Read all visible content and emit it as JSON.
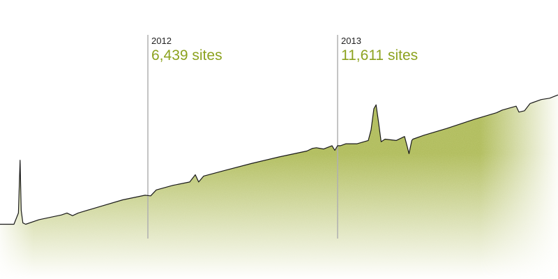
{
  "colors": {
    "accent": "#8ca21f",
    "fill": "#b9c56a",
    "line": "#1a1a1a",
    "marker_line": "#b0b0b0"
  },
  "annotations": [
    {
      "year": "2012",
      "value": "6,439 sites"
    },
    {
      "year": "2013",
      "value": "11,611 sites"
    }
  ],
  "chart_data": {
    "type": "area",
    "title": "",
    "xlabel": "",
    "ylabel": "",
    "grid": false,
    "legend": "none",
    "markers": [
      {
        "x": 26.5,
        "label": "2012",
        "value_label": "6,439 sites",
        "value": 6439
      },
      {
        "x": 60.5,
        "label": "2013",
        "value_label": "11,611 sites",
        "value": 11611
      }
    ],
    "series": [
      {
        "x": [
          0,
          2.5,
          3.3,
          3.6,
          3.8,
          4.1,
          4.6,
          7,
          11,
          12,
          13,
          14,
          18,
          22,
          26,
          27,
          28,
          31,
          34,
          35,
          35.6,
          36.5,
          40,
          45,
          50,
          55,
          56,
          56.7,
          58,
          59.5,
          60,
          60.5,
          61,
          62,
          64,
          66,
          66.5,
          67,
          67.4,
          67.8,
          68.3,
          69,
          71,
          72.5,
          73,
          73.3,
          73.8,
          74,
          76,
          80,
          85,
          89,
          90,
          92.5,
          93,
          94,
          95,
          97,
          98.5,
          100
        ],
        "y": [
          4150,
          4150,
          5000,
          9000,
          5200,
          4250,
          4150,
          4500,
          4850,
          5000,
          4800,
          5000,
          5500,
          6000,
          6350,
          6300,
          6750,
          7100,
          7350,
          7900,
          7350,
          7800,
          8200,
          8750,
          9250,
          9700,
          9900,
          9950,
          9850,
          10100,
          9750,
          10100,
          10100,
          10250,
          10250,
          10500,
          11300,
          12900,
          13200,
          12000,
          10400,
          10600,
          10500,
          10800,
          10000,
          9500,
          10500,
          10600,
          10900,
          11400,
          12100,
          12600,
          12800,
          13100,
          12650,
          12750,
          13300,
          13600,
          13700,
          13950
        ]
      }
    ],
    "xlim": [
      0,
      100
    ],
    "ylim": [
      0,
      18500
    ]
  }
}
